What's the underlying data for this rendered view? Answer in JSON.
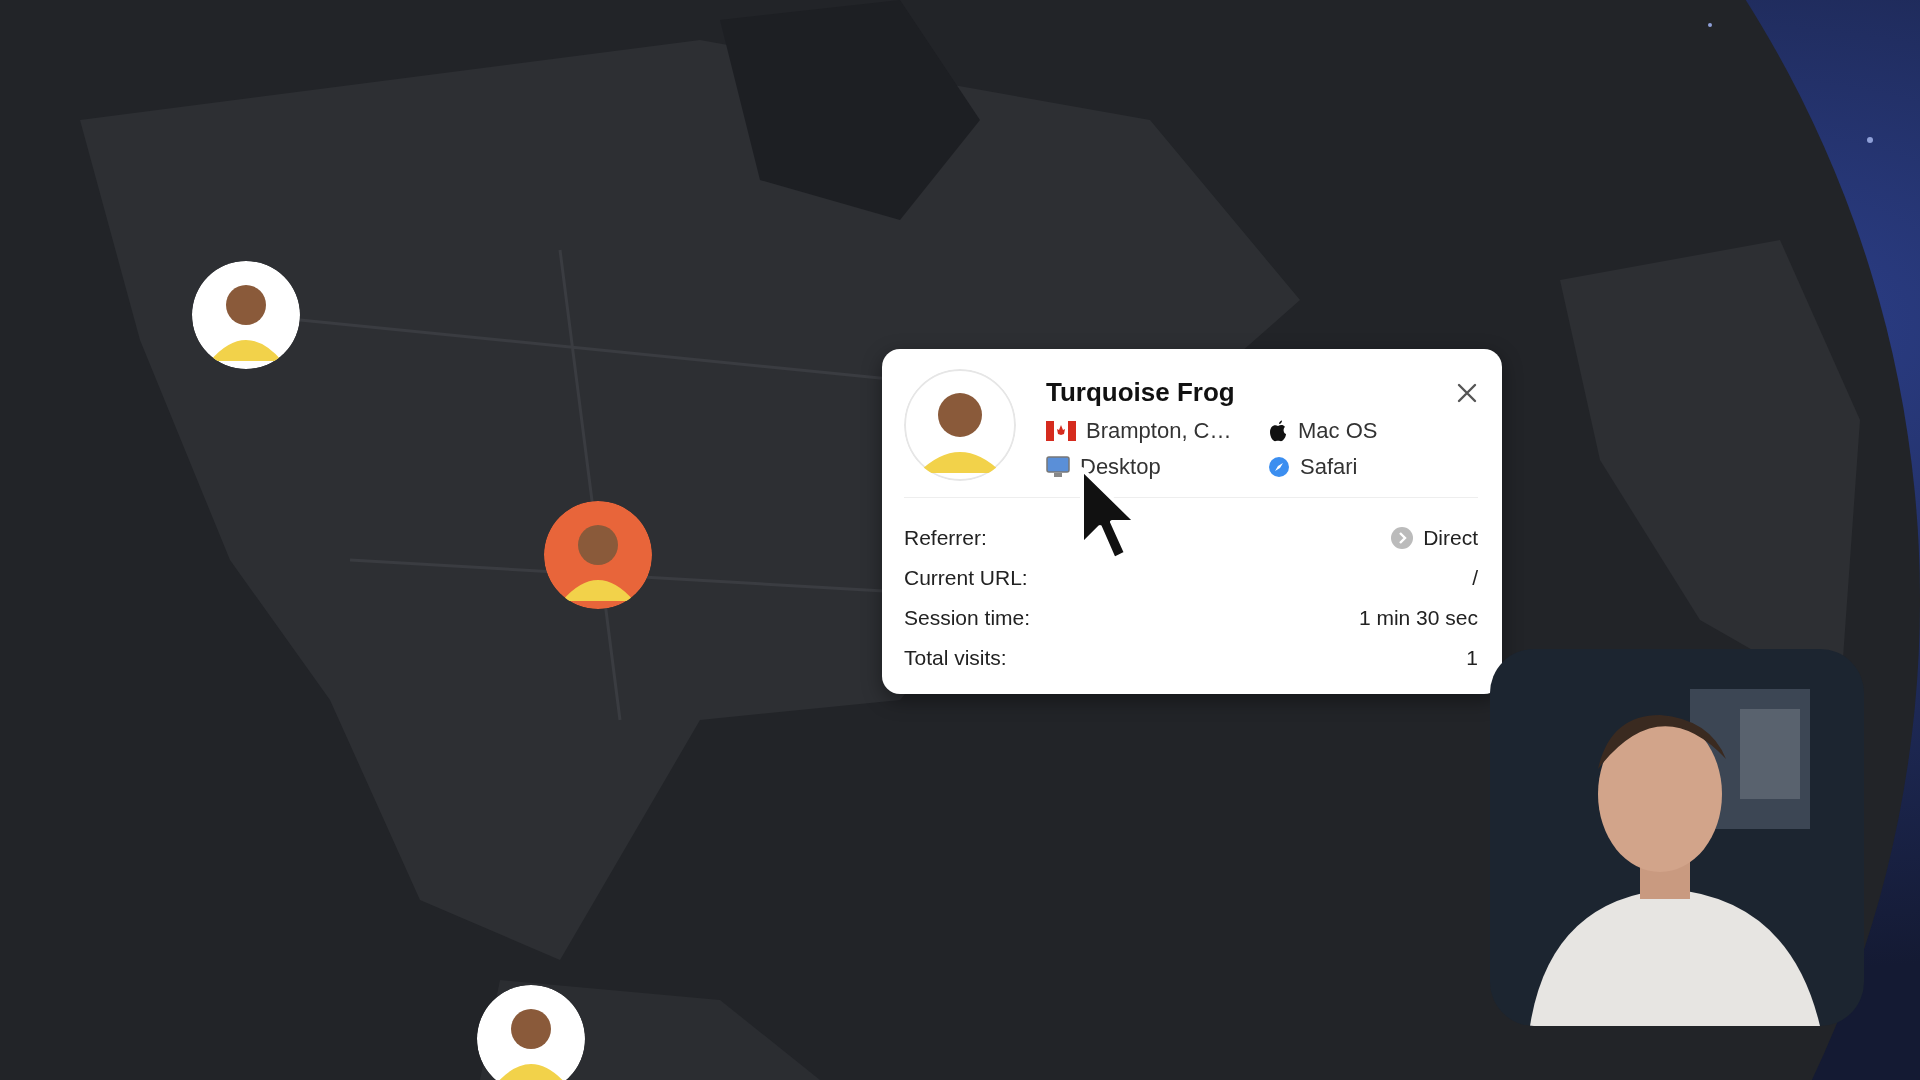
{
  "markers": [
    {
      "color": "#ffffff"
    },
    {
      "color": "#e8653a"
    },
    {
      "color": "#ffffff"
    }
  ],
  "visitor_card": {
    "name": "Turquoise Frog",
    "location": "Brampton, C…",
    "os": "Mac OS",
    "device": "Desktop",
    "browser": "Safari",
    "rows": [
      {
        "label": "Referrer:",
        "value": "Direct",
        "kind": "referrer"
      },
      {
        "label": "Current URL:",
        "value": "/",
        "kind": "plain"
      },
      {
        "label": "Session time:",
        "value": "1 min 30 sec",
        "kind": "plain"
      },
      {
        "label": "Total visits:",
        "value": "1",
        "kind": "plain"
      }
    ]
  }
}
